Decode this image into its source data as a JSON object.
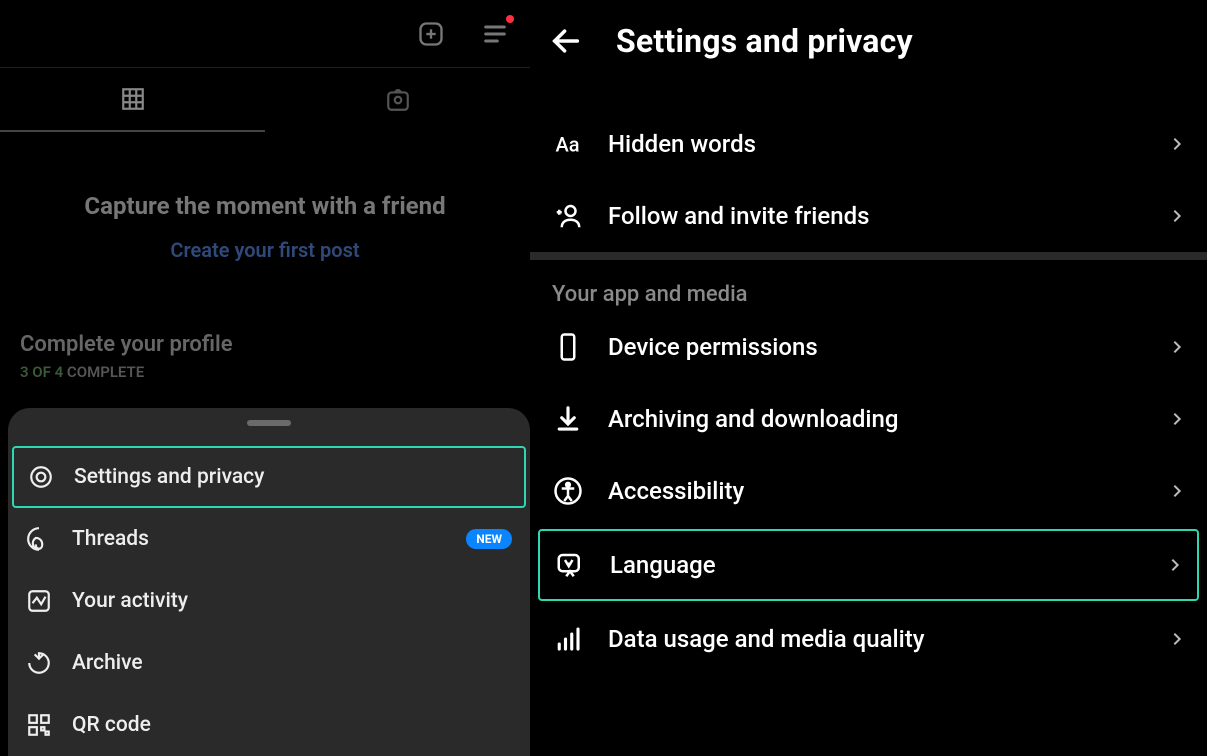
{
  "left": {
    "cta_title": "Capture the moment with a friend",
    "cta_link": "Create your first post",
    "complete_title": "Complete your profile",
    "complete_fraction": "3 OF 4",
    "complete_word": "COMPLETE",
    "menu": {
      "settings": "Settings and privacy",
      "threads": "Threads",
      "threads_badge": "NEW",
      "activity": "Your activity",
      "archive": "Archive",
      "qr": "QR code"
    }
  },
  "right": {
    "title": "Settings and privacy",
    "items": {
      "hidden_words": "Hidden words",
      "follow_invite": "Follow and invite friends",
      "section_app_media": "Your app and media",
      "device_permissions": "Device permissions",
      "archiving": "Archiving and downloading",
      "accessibility": "Accessibility",
      "language": "Language",
      "data_usage": "Data usage and media quality"
    }
  }
}
